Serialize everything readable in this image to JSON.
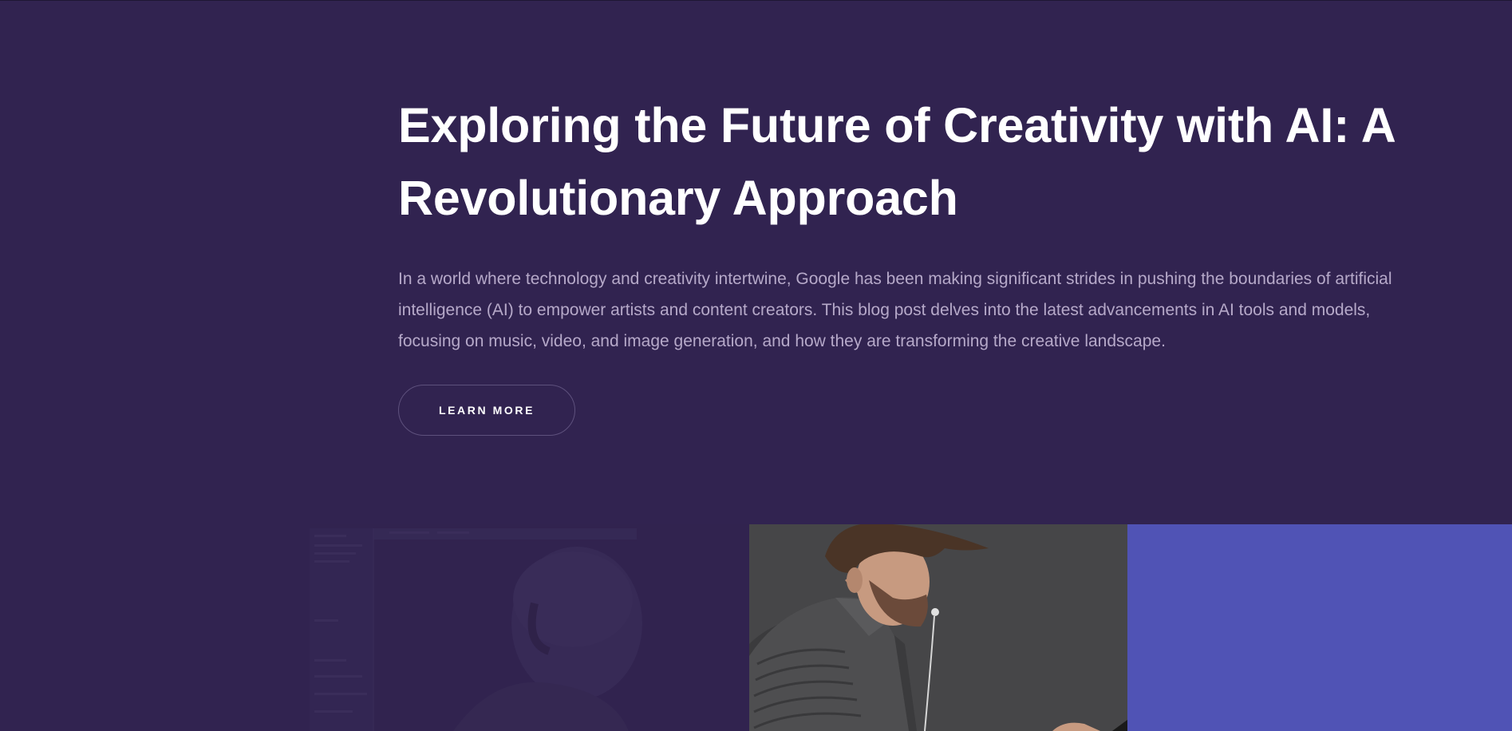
{
  "hero": {
    "title_line1": "Exploring the Future of Creativity with AI: A",
    "title_line2": "Revolutionary Approach",
    "description": "In a world where technology and creativity intertwine, Google has been making significant strides in pushing the boundaries of artificial intelligence (AI) to empower artists and content creators. This blog post delves into the latest advancements in AI tools and models, focusing on music, video, and image generation, and how they are transforming the creative landscape.",
    "cta_label": "LEARN MORE"
  },
  "colors": {
    "background": "#312350",
    "title": "#ffffff",
    "description": "#b6a9c9",
    "button_border": "#5e517d",
    "accent_block": "#5053b5",
    "photo_background": "#444446"
  },
  "images": {
    "faded_background": "faded-musician-with-headphones-and-daw-screen",
    "photo": "man-with-earphones-looking-down"
  }
}
